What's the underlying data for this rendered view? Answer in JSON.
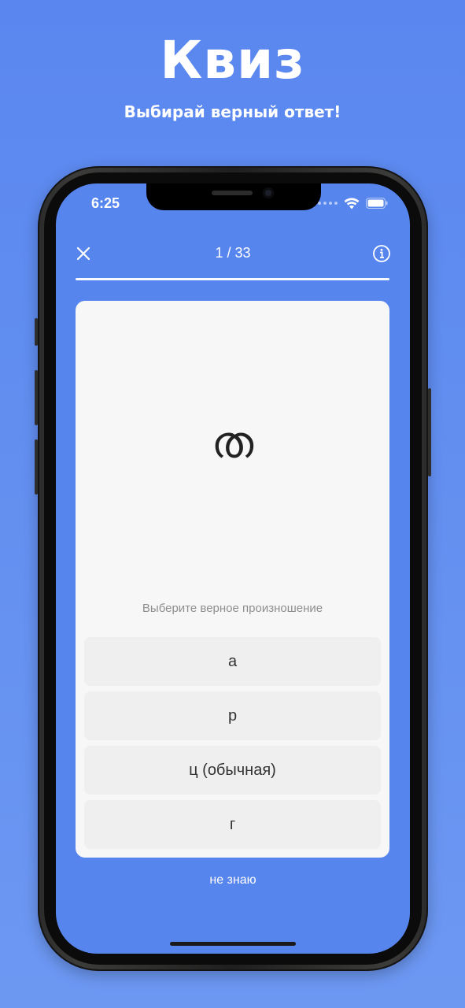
{
  "promo": {
    "title": "Квиз",
    "subtitle": "Выбирай верный ответ!"
  },
  "status_bar": {
    "time": "6:25",
    "icons": [
      "signal-dots-icon",
      "wifi-icon",
      "battery-icon"
    ]
  },
  "nav": {
    "close_icon": "close-icon",
    "progress_label": "1 / 33",
    "info_icon": "info-icon"
  },
  "progress": {
    "current": 1,
    "total": 33
  },
  "card": {
    "glyph": "ത",
    "prompt": "Выберите верное произношение",
    "answers": [
      "а",
      "р",
      "ц (обычная)",
      "г"
    ]
  },
  "dont_know_label": "не знаю",
  "colors": {
    "background": "#5a87ef",
    "screen": "#5785ee",
    "card": "#f7f7f7",
    "answer": "#efefef",
    "prompt_text": "#8e8e8e"
  }
}
